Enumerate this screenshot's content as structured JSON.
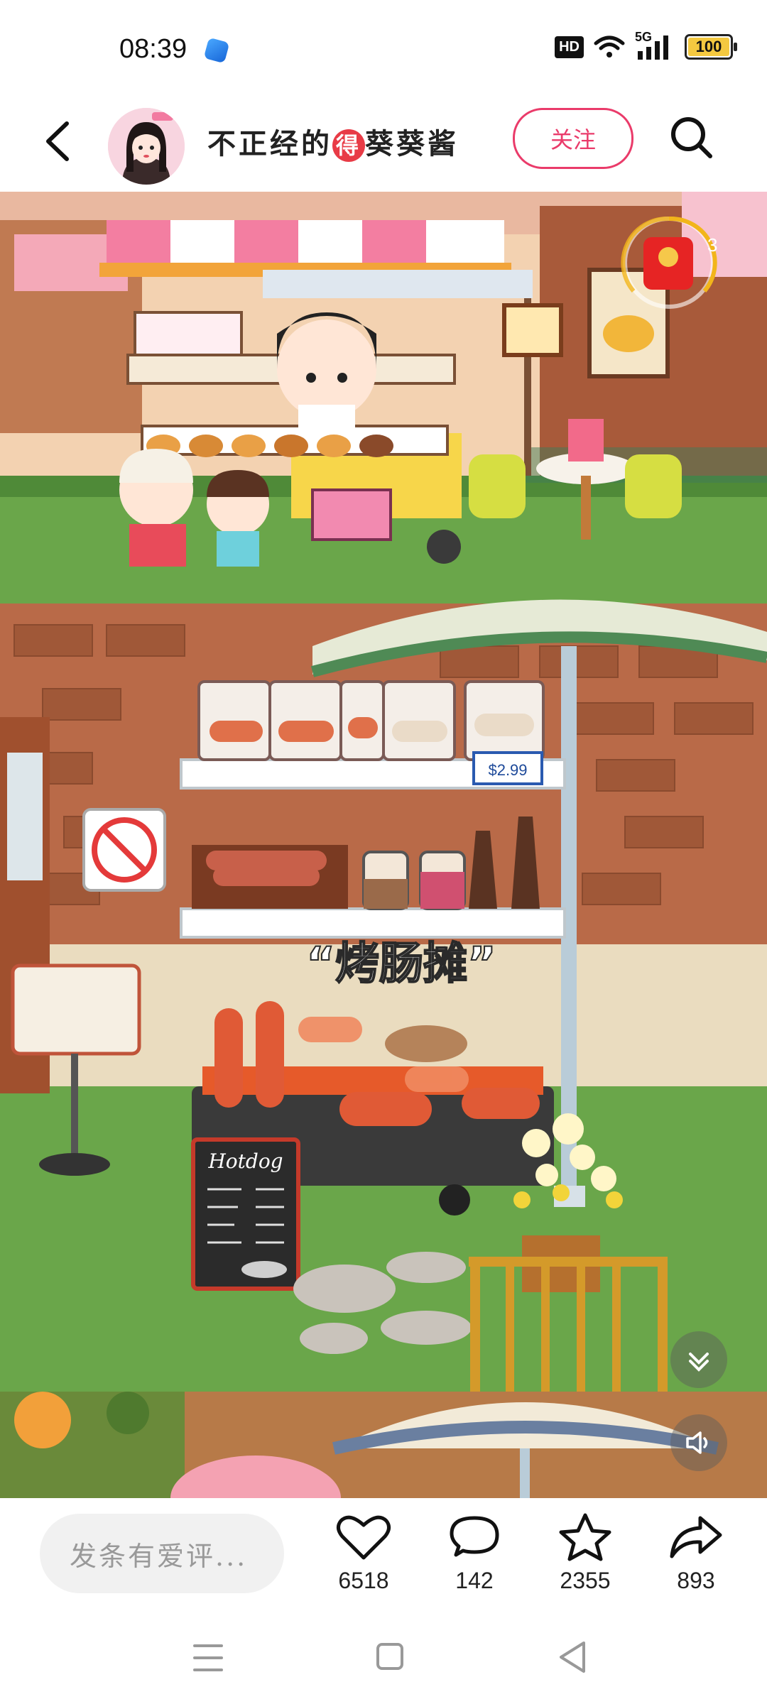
{
  "status_bar": {
    "time": "08:39",
    "hd_label": "HD",
    "network": "5G",
    "battery": "100"
  },
  "header": {
    "author_prefix": "不正经的",
    "author_badge": "得",
    "author_suffix": "葵葵酱",
    "follow_label": "关注"
  },
  "post": {
    "caption": "“烤肠摊”",
    "price_tag": "$2.99",
    "menu_title": "Hotdog",
    "red_packet_count": "3"
  },
  "bottom_bar": {
    "comment_placeholder": "发条有爱评...",
    "like_count": "6518",
    "comment_count": "142",
    "favorite_count": "2355",
    "share_count": "893"
  },
  "colors": {
    "accent": "#ea3b6a",
    "brand_red": "#e83b46"
  }
}
